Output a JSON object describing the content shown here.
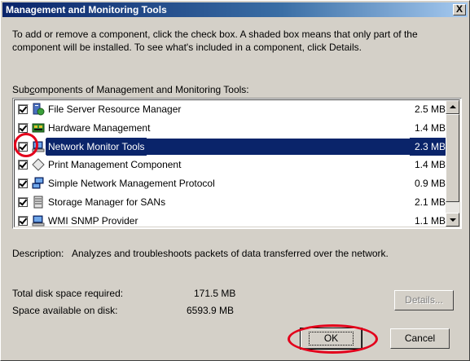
{
  "window": {
    "title": "Management and Monitoring Tools",
    "close_glyph": "X"
  },
  "intro_text": "To add or remove a component, click the check box. A shaded box means that only part of the component will be installed. To see what's included in a component, click Details.",
  "subcomponents_label": {
    "pre": "Sub",
    "accel": "c",
    "post": "omponents of Management and Monitoring Tools:"
  },
  "components": [
    {
      "name": "File Server Resource Manager",
      "size": "2.5 MB",
      "checked": true,
      "icon": "server-icon"
    },
    {
      "name": "Hardware Management",
      "size": "1.4 MB",
      "checked": true,
      "icon": "chip-icon"
    },
    {
      "name": "Network Monitor Tools",
      "size": "2.3 MB",
      "checked": true,
      "icon": "computer-icon",
      "selected": true
    },
    {
      "name": "Print Management Component",
      "size": "1.4 MB",
      "checked": true,
      "icon": "diamond-icon"
    },
    {
      "name": "Simple Network Management Protocol",
      "size": "0.9 MB",
      "checked": true,
      "icon": "network-icon"
    },
    {
      "name": "Storage Manager for SANs",
      "size": "2.1 MB",
      "checked": true,
      "icon": "storage-icon"
    },
    {
      "name": "WMI SNMP Provider",
      "size": "1.1 MB",
      "checked": true,
      "icon": "computer-icon"
    }
  ],
  "description": {
    "label": "Description:",
    "text": "Analyzes and troubleshoots packets of data transferred over the network."
  },
  "disk": {
    "required_label": "Total disk space required:",
    "required_value": "171.5 MB",
    "available_label": "Space available on disk:",
    "available_value": "6593.9 MB"
  },
  "buttons": {
    "details": "Details...",
    "ok": "OK",
    "cancel": "Cancel"
  },
  "colors": {
    "selection": "#0a246a",
    "highlight_circle": "#e3001b"
  }
}
